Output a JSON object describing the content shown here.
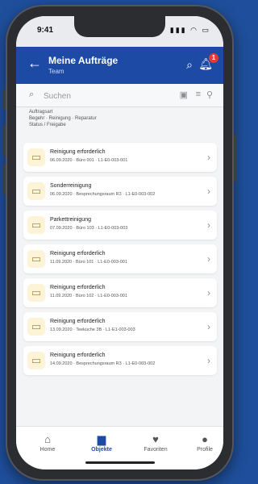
{
  "status_bar": {
    "time": "9:41",
    "icons": "▮▮▮ ◠ ▭"
  },
  "app_bar": {
    "title": "Meine Aufträge",
    "subtitle": "Team",
    "notification_count": "1"
  },
  "search": {
    "placeholder": "Suchen",
    "value": ""
  },
  "filters": {
    "line1": "Auftragsart",
    "line2": "Begehr · Reinigung · Reparatur",
    "line3": "Status / Freigabe"
  },
  "jobs": [
    {
      "title": "Reinigung erforderlich",
      "subtitle": "06.09.2020 · Büro 001 · L1-E0-003-001"
    },
    {
      "title": "Sonderreinigung",
      "subtitle": "06.09.2020 · Besprechungsraum R3 · L1-E0-003-002"
    },
    {
      "title": "Parkettreinigung",
      "subtitle": "07.09.2020 · Büro 103 · L1-E0-003-003"
    },
    {
      "title": "Reinigung erforderlich",
      "subtitle": "11.09.2020 · Büro 101 · L1-E0-003-001"
    },
    {
      "title": "Reinigung erforderlich",
      "subtitle": "11.09.2020 · Büro 102 · L1-E0-003-001"
    },
    {
      "title": "Reinigung erforderlich",
      "subtitle": "13.09.2020 · Teeküche 3B · L1-E1-003-003"
    },
    {
      "title": "Reinigung erforderlich",
      "subtitle": "14.09.2020 · Besprechungsraum R3 · L1-E0-003-002"
    }
  ],
  "bottom_nav": [
    {
      "label": "Home",
      "icon": "home-icon",
      "glyph": "⌂"
    },
    {
      "label": "Objekte",
      "icon": "folder-icon",
      "glyph": "▆"
    },
    {
      "label": "Favoriten",
      "icon": "heart-icon",
      "glyph": "♥"
    },
    {
      "label": "Profile",
      "icon": "person-icon",
      "glyph": "●"
    }
  ],
  "colors": {
    "accent": "#1d4aa5",
    "badge": "#e53935",
    "folder": "#fdf3d7"
  }
}
